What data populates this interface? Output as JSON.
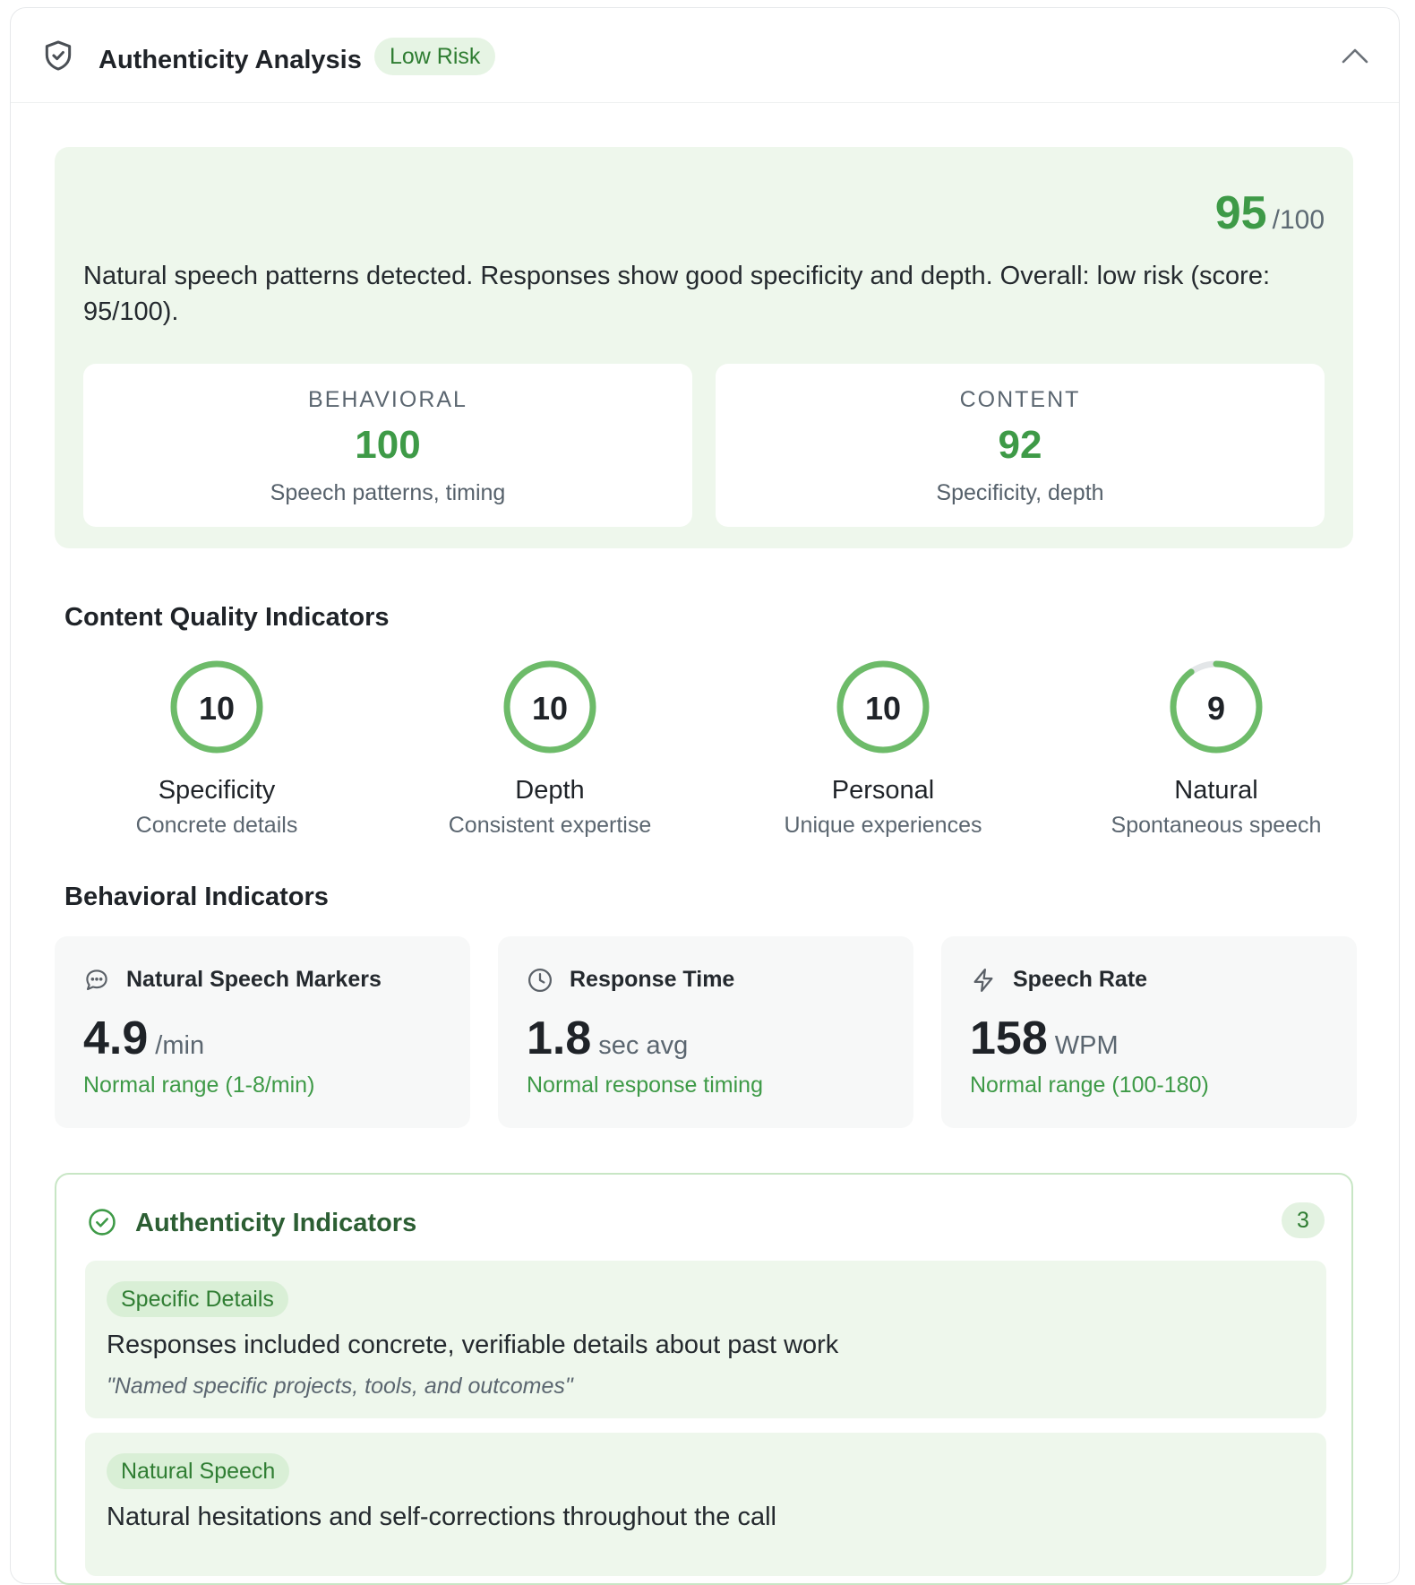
{
  "header": {
    "title": "Authenticity Analysis",
    "risk_badge": "Low Risk"
  },
  "summary": {
    "score": "95",
    "score_max": "/100",
    "text": "Natural speech patterns detected. Responses show good specificity and depth. Overall: low risk (score: 95/100).",
    "behavioral": {
      "label": "BEHAVIORAL",
      "value": "100",
      "desc": "Speech patterns, timing"
    },
    "content": {
      "label": "CONTENT",
      "value": "92",
      "desc": "Specificity, depth"
    }
  },
  "content_quality": {
    "title": "Content Quality Indicators",
    "max": 10,
    "items": [
      {
        "value": 10,
        "label": "Specificity",
        "desc": "Concrete details"
      },
      {
        "value": 10,
        "label": "Depth",
        "desc": "Consistent expertise"
      },
      {
        "value": 10,
        "label": "Personal",
        "desc": "Unique experiences"
      },
      {
        "value": 9,
        "label": "Natural",
        "desc": "Spontaneous speech"
      }
    ]
  },
  "behavioral": {
    "title": "Behavioral Indicators",
    "cards": [
      {
        "icon": "chat-bubble-icon",
        "title": "Natural Speech Markers",
        "value": "4.9",
        "unit": "/min",
        "note": "Normal range (1-8/min)"
      },
      {
        "icon": "clock-icon",
        "title": "Response Time",
        "value": "1.8",
        "unit": "sec avg",
        "note": "Normal response timing"
      },
      {
        "icon": "lightning-icon",
        "title": "Speech Rate",
        "value": "158",
        "unit": "WPM",
        "note": "Normal range (100-180)"
      }
    ]
  },
  "indicators": {
    "title": "Authenticity Indicators",
    "count": "3",
    "items": [
      {
        "tag": "Specific Details",
        "text": "Responses included concrete, verifiable details about past work",
        "quote": "\"Named specific projects, tools, and outcomes\""
      },
      {
        "tag": "Natural Speech",
        "text": "Natural hesitations and self-corrections throughout the call",
        "quote": ""
      }
    ]
  },
  "colors": {
    "accent_green": "#3e9a47",
    "ring_track": "#e3e6e8",
    "summary_bg": "#eef7ec"
  }
}
